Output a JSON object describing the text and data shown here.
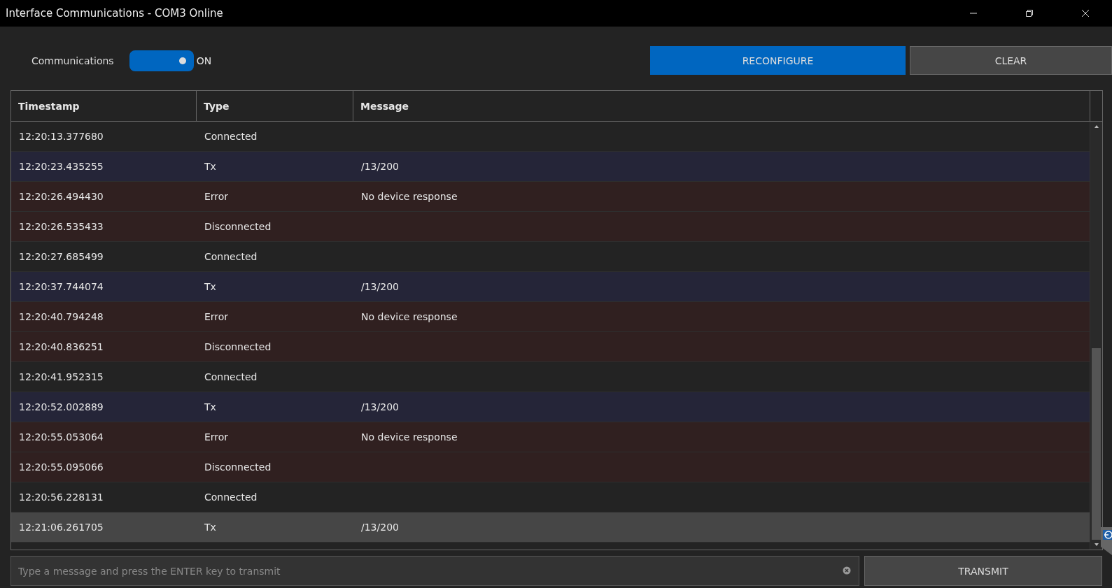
{
  "window": {
    "title": "Interface Communications - COM3 Online"
  },
  "communications": {
    "label": "Communications",
    "on": true,
    "state_text": "ON"
  },
  "buttons": [
    {
      "label": "RECONFIGURE",
      "primary": true
    },
    {
      "label": "CLEAR",
      "primary": false
    }
  ],
  "table": {
    "columns": [
      "Timestamp",
      "Type",
      "Message"
    ],
    "rows": [
      {
        "kind": "connected",
        "selected": false,
        "cells": [
          "12:20:13.377680",
          "Connected",
          ""
        ]
      },
      {
        "kind": "tx",
        "selected": false,
        "cells": [
          "12:20:23.435255",
          "Tx",
          "/13/200"
        ]
      },
      {
        "kind": "error",
        "selected": false,
        "cells": [
          "12:20:26.494430",
          "Error",
          "No device response"
        ]
      },
      {
        "kind": "error",
        "selected": false,
        "cells": [
          "12:20:26.535433",
          "Disconnected",
          ""
        ]
      },
      {
        "kind": "connected",
        "selected": false,
        "cells": [
          "12:20:27.685499",
          "Connected",
          ""
        ]
      },
      {
        "kind": "tx",
        "selected": false,
        "cells": [
          "12:20:37.744074",
          "Tx",
          "/13/200"
        ]
      },
      {
        "kind": "error",
        "selected": false,
        "cells": [
          "12:20:40.794248",
          "Error",
          "No device response"
        ]
      },
      {
        "kind": "error",
        "selected": false,
        "cells": [
          "12:20:40.836251",
          "Disconnected",
          ""
        ]
      },
      {
        "kind": "connected",
        "selected": false,
        "cells": [
          "12:20:41.952315",
          "Connected",
          ""
        ]
      },
      {
        "kind": "tx",
        "selected": false,
        "cells": [
          "12:20:52.002889",
          "Tx",
          "/13/200"
        ]
      },
      {
        "kind": "error",
        "selected": false,
        "cells": [
          "12:20:55.053064",
          "Error",
          "No device response"
        ]
      },
      {
        "kind": "error",
        "selected": false,
        "cells": [
          "12:20:55.095066",
          "Disconnected",
          ""
        ]
      },
      {
        "kind": "connected",
        "selected": false,
        "cells": [
          "12:20:56.228131",
          "Connected",
          ""
        ]
      },
      {
        "kind": "tx",
        "selected": true,
        "cells": [
          "12:21:06.261705",
          "Tx",
          "/13/200"
        ]
      }
    ]
  },
  "message_input": {
    "placeholder": "Type a message and press the ENTER key to transmit"
  },
  "transmit_button": {
    "label": "TRANSMIT"
  }
}
